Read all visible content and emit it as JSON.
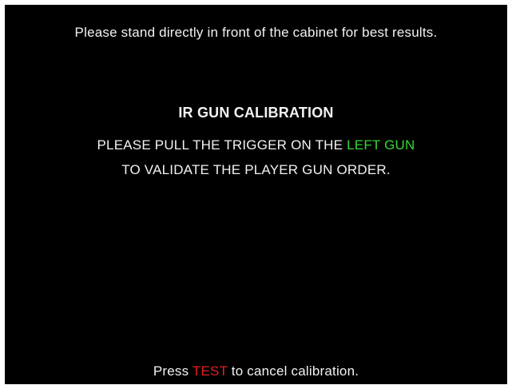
{
  "screen": {
    "top_hint": "Please stand directly in front of the cabinet for best results.",
    "title": "IR GUN CALIBRATION",
    "instruction_line1_prefix": "PLEASE PULL THE TRIGGER ON THE ",
    "instruction_line1_highlight": "LEFT GUN",
    "instruction_line2": "TO VALIDATE THE PLAYER GUN ORDER.",
    "cancel_prefix": "Press ",
    "cancel_key": "TEST",
    "cancel_suffix": " to cancel calibration."
  },
  "colors": {
    "background": "#000000",
    "text": "#f2f2f2",
    "highlight_green": "#35d635",
    "highlight_red": "#e32020"
  }
}
